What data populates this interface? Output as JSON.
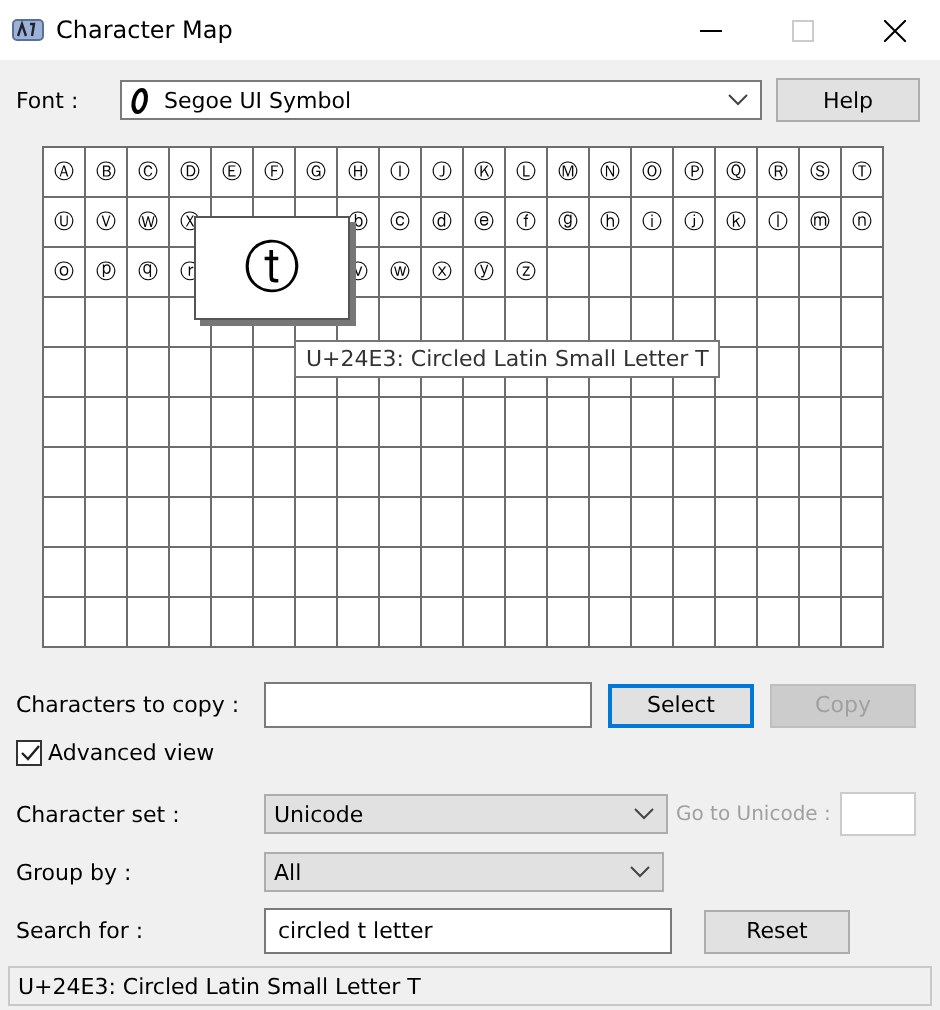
{
  "window": {
    "title": "Character Map"
  },
  "font": {
    "label": "Font :",
    "value": "Segoe UI Symbol"
  },
  "help_button": "Help",
  "grid": {
    "rows": [
      [
        "Ⓐ",
        "Ⓑ",
        "Ⓒ",
        "Ⓓ",
        "Ⓔ",
        "Ⓕ",
        "Ⓖ",
        "Ⓗ",
        "Ⓘ",
        "Ⓙ",
        "Ⓚ",
        "Ⓛ",
        "Ⓜ",
        "Ⓝ",
        "Ⓞ",
        "Ⓟ",
        "Ⓠ",
        "Ⓡ",
        "Ⓢ",
        "Ⓣ"
      ],
      [
        "Ⓤ",
        "Ⓥ",
        "Ⓦ",
        "Ⓧ",
        null,
        null,
        null,
        "ⓑ",
        "ⓒ",
        "ⓓ",
        "ⓔ",
        "ⓕ",
        "ⓖ",
        "ⓗ",
        "ⓘ",
        "ⓙ",
        "ⓚ",
        "ⓛ",
        "ⓜ",
        "ⓝ"
      ],
      [
        "ⓞ",
        "ⓟ",
        "ⓠ",
        "ⓡ",
        null,
        null,
        null,
        "ⓥ",
        "ⓦ",
        "ⓧ",
        "ⓨ",
        "ⓩ"
      ]
    ],
    "magnified": "ⓣ",
    "tooltip": "U+24E3: Circled Latin Small Letter T"
  },
  "copy": {
    "label": "Characters to copy :",
    "select_button": "Select",
    "copy_button": "Copy",
    "copy_disabled": true
  },
  "advanced_view": {
    "label": "Advanced view",
    "checked": true
  },
  "character_set": {
    "label": "Character set :",
    "value": "Unicode"
  },
  "go_to_unicode": {
    "label": "Go to Unicode :",
    "disabled": true
  },
  "group_by": {
    "label": "Group by :",
    "value": "All"
  },
  "search": {
    "label": "Search for :",
    "value": "circled t letter",
    "reset_button": "Reset"
  },
  "status_bar": "U+24E3: Circled Latin Small Letter T"
}
